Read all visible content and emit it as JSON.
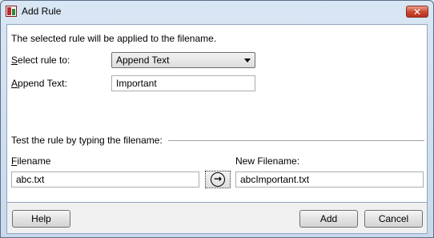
{
  "window": {
    "title": "Add Rule",
    "close_glyph": "✕"
  },
  "intro_text": "The selected rule will be applied to the filename.",
  "rule": {
    "select_label_access": "S",
    "select_label_rest": "elect rule to:",
    "select_value": "Append Text",
    "append_label_access": "A",
    "append_label_rest": "ppend Text:",
    "append_value": "Important"
  },
  "test": {
    "section_label": "Test the rule by typing the filename:",
    "filename_label_access": "F",
    "filename_label_rest": "ilename",
    "filename_value": "abc.txt",
    "arrow_glyph": "→",
    "new_filename_label": "New Filename:",
    "new_filename_value": "abcImportant.txt"
  },
  "buttons": {
    "help": "Help",
    "add": "Add",
    "cancel": "Cancel"
  },
  "icons": {
    "app": "app-icon",
    "close": "close-icon",
    "go": "arrow-right-circle-icon"
  }
}
